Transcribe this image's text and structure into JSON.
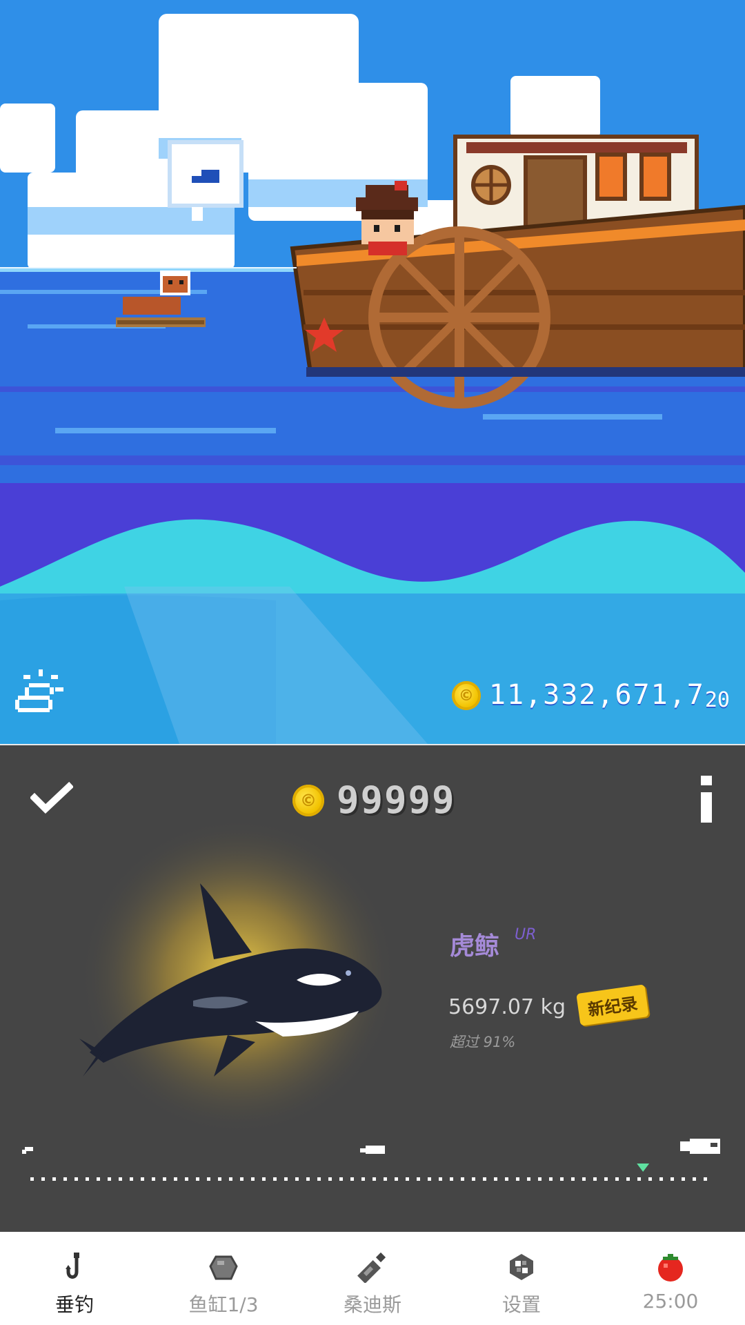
{
  "scene": {
    "total_coins": "11,332,671,7",
    "total_coins_tail": "20",
    "weather_icon": "weather-icon"
  },
  "catch": {
    "price": "99999",
    "fish_name": "虎鲸",
    "rarity": "UR",
    "weight": "5697.07 kg",
    "record_badge": "新纪录",
    "percentile": "超过 91%",
    "weight_position_fraction": 0.91,
    "fish_icon": "orca-icon"
  },
  "nav": {
    "items": [
      {
        "label": "垂钓",
        "icon": "fishing-hook-icon",
        "active": true
      },
      {
        "label": "鱼缸1/3",
        "icon": "fish-tank-icon",
        "active": false
      },
      {
        "label": "桑迪斯",
        "icon": "bottle-icon",
        "active": false
      },
      {
        "label": "设置",
        "icon": "settings-icon",
        "active": false
      },
      {
        "label": "25:00",
        "icon": "tomato-timer-icon",
        "active": false
      }
    ]
  },
  "colors": {
    "sky": "#2f8fe8",
    "sea": "#2f6fe0",
    "deep_wave": "#4a3fd6",
    "panel": "#454545",
    "coin": "#f2c200",
    "rarity": "#7d5fd0",
    "badge": "#f7c51a"
  }
}
